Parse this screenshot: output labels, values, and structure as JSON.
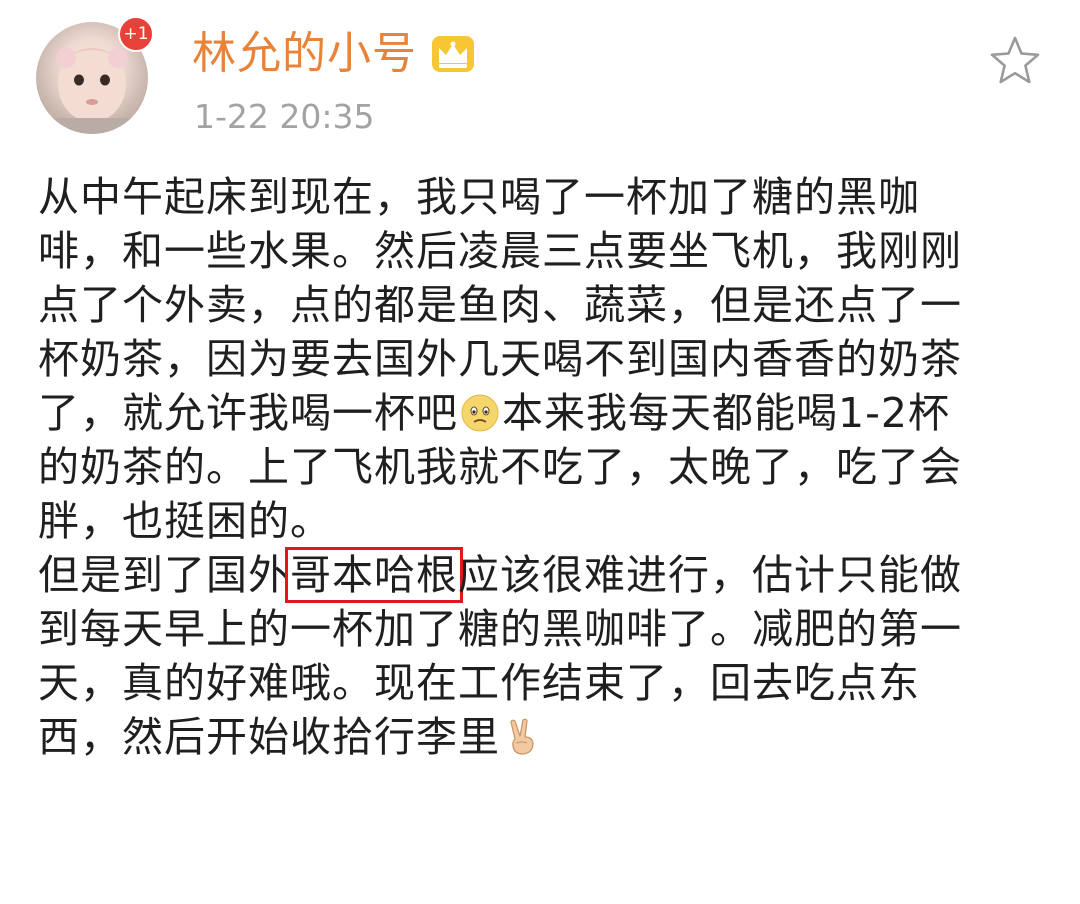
{
  "header": {
    "badge": "+1",
    "username": "林允的小号",
    "timestamp": "1-22 20:35"
  },
  "icons": {
    "crown": "crown-icon",
    "favorite": "star-icon",
    "worried_emoji": "worried-face-icon",
    "victory_emoji": "victory-hand-icon"
  },
  "post": {
    "lines": [
      "从中午起床到现在，我只喝了一杯加了糖的黑咖",
      "啡，和一些水果。然后凌晨三点要坐飞机，我刚刚",
      "点了个外卖，点的都是鱼肉、蔬菜，但是还点了一",
      "杯奶茶，因为要去国外几天喝不到国内香香的奶茶",
      "了，就允许我喝一杯吧",
      "本来我每天都能喝1-2杯",
      "的奶茶的。上了飞机我就不吃了，太晚了，吃了会",
      "胖，也挺困的。",
      "但是到了国外",
      "哥本哈根",
      "应该很难进行，估计只能做",
      "到每天早上的一杯加了糖的黑咖啡了。减肥的第一",
      "天，真的好难哦。现在工作结束了，回去吃点东",
      "西，然后开始收拾行李里"
    ]
  },
  "colors": {
    "username": "#e8843a",
    "timestamp": "#a3a3a3",
    "text": "#1f1f1f",
    "highlight_box": "#e0171c",
    "badge": "#e8413a"
  }
}
